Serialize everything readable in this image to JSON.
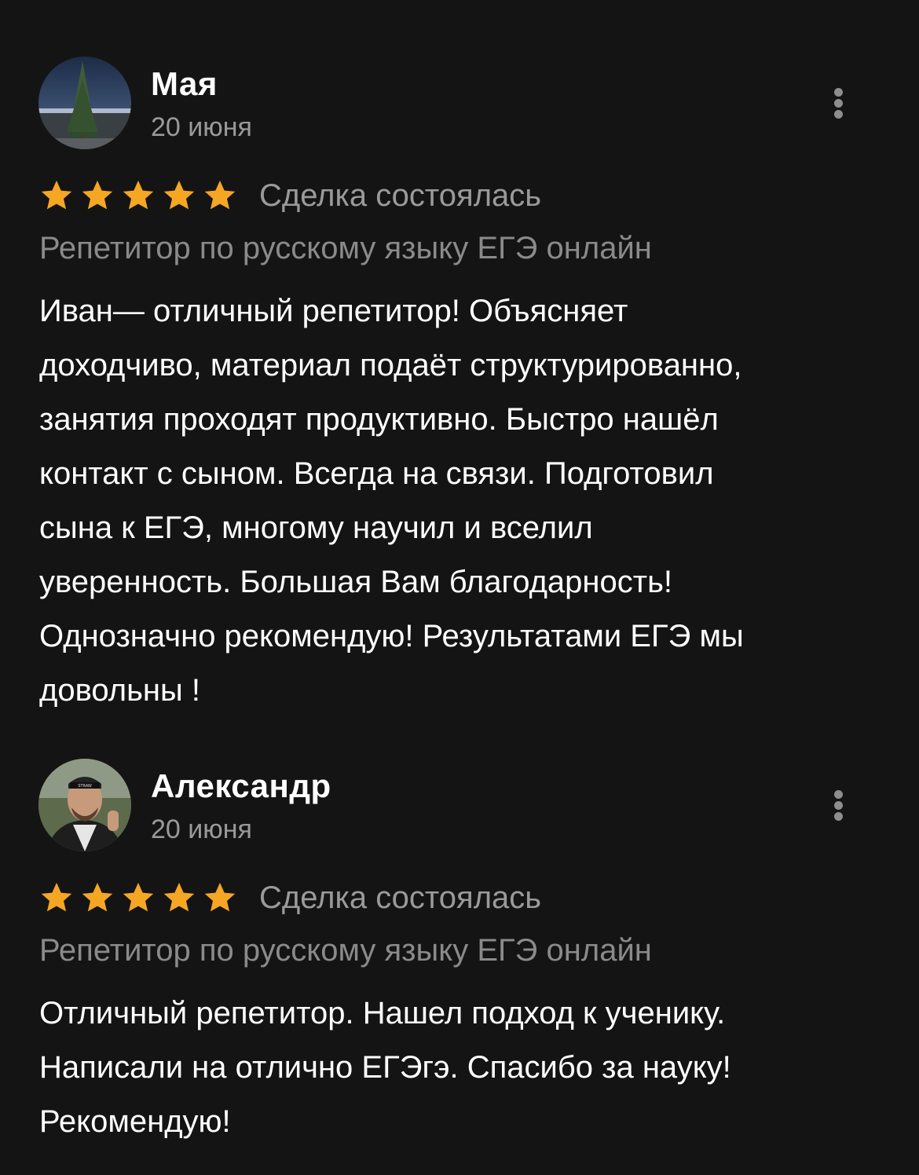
{
  "colors": {
    "background": "#141414",
    "star": "#f5a623",
    "secondary_text": "#9a9a9a"
  },
  "reviews": [
    {
      "author": "Мая",
      "date": "20 июня",
      "rating": 5,
      "deal_status": "Сделка состоялась",
      "service": "Репетитор по русскому языку ЕГЭ онлайн",
      "text_lines": [
        "Иван— отличный репетитор! Объясняет",
        "доходчиво, материал подаёт структурированно,",
        "занятия проходят продуктивно. Быстро нашёл",
        "контакт с сыном. Всегда на связи. Подготовил",
        "сына к ЕГЭ, многому научил и вселил",
        "уверенность. Большая Вам благодарность!",
        "Однозначно рекомендую! Результатами ЕГЭ мы",
        "довольны !"
      ],
      "more_icon": "more-vertical-icon"
    },
    {
      "author": "Александр",
      "date": "20 июня",
      "rating": 5,
      "deal_status": "Сделка состоялась",
      "service": "Репетитор по русскому языку ЕГЭ онлайн",
      "text_lines": [
        "Отличный репетитор. Нашел подход к ученику.",
        "Написали на отлично ЕГЭгэ. Спасибо за науку!",
        "Рекомендую!"
      ],
      "more_icon": "more-vertical-icon"
    }
  ]
}
